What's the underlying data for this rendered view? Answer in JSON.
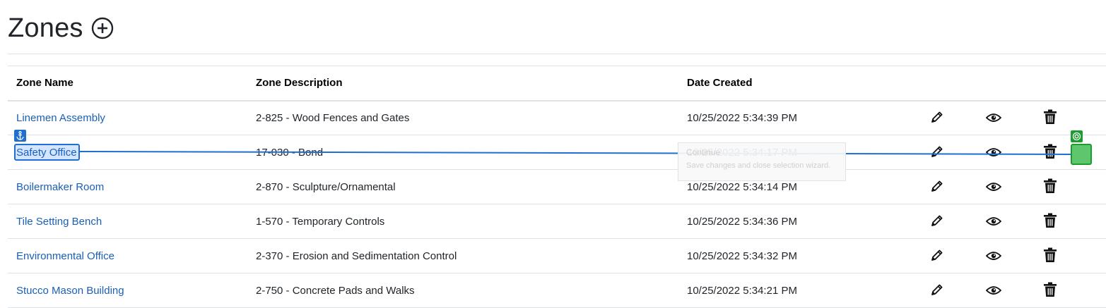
{
  "page": {
    "title": "Zones"
  },
  "header_icons": {
    "add": "plus-circle-icon"
  },
  "table": {
    "columns": [
      "Zone Name",
      "Zone Description",
      "Date Created"
    ],
    "rows": [
      {
        "name": "Linemen Assembly",
        "description": "2-825 - Wood Fences and Gates",
        "date": "10/25/2022 5:34:39 PM"
      },
      {
        "name": "Safety Office",
        "description": "17-030 - Bond",
        "date": "10/25/2022 5:34:17 PM"
      },
      {
        "name": "Boilermaker Room",
        "description": "2-870 - Sculpture/Ornamental",
        "date": "10/25/2022 5:34:14 PM"
      },
      {
        "name": "Tile Setting Bench",
        "description": "1-570 - Temporary Controls",
        "date": "10/25/2022 5:34:36 PM"
      },
      {
        "name": "Environmental Office",
        "description": "2-370 - Erosion and Sedimentation Control",
        "date": "10/25/2022 5:34:32 PM"
      },
      {
        "name": "Stucco Mason Building",
        "description": "2-750 - Concrete Pads and Walks",
        "date": "10/25/2022 5:34:21 PM"
      }
    ],
    "row_action_icons": [
      "pencil-icon",
      "eye-icon",
      "trash-icon"
    ]
  },
  "overlay": {
    "tooltip_title": "Continue",
    "tooltip_text": "Save changes and close selection wizard.",
    "selection_color": "#1f6fd0",
    "target_color": "#1c9c2e"
  }
}
